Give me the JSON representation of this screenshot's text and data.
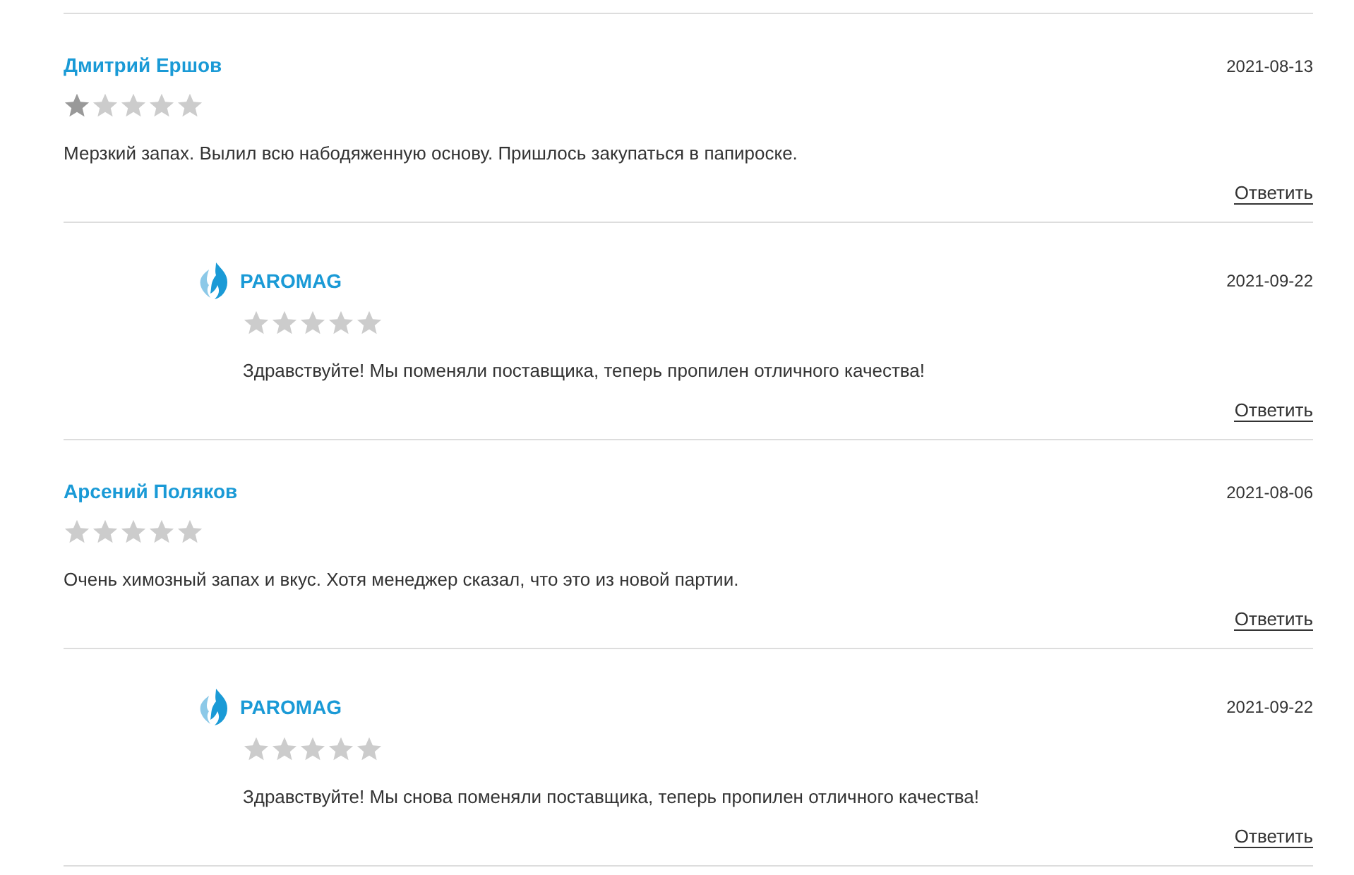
{
  "reviews": [
    {
      "kind": "customer",
      "author": "Дмитрий Ершов",
      "date": "2021-08-13",
      "stars": 1,
      "text": "Мерзкий запах. Вылил всю набодяженную основу. Пришлось закупаться в папироске.",
      "reply_link": "Ответить"
    },
    {
      "kind": "shop",
      "author": "PAROMAG",
      "date": "2021-09-22",
      "stars": 0,
      "text": "Здравствуйте! Мы поменяли поставщика, теперь пропилен отличного качества!",
      "reply_link": "Ответить"
    },
    {
      "kind": "customer",
      "author": "Арсений Поляков",
      "date": "2021-08-06",
      "stars": 0,
      "text": "Очень химозный запах и вкус. Хотя менеджер сказал, что это из новой партии.",
      "reply_link": "Ответить"
    },
    {
      "kind": "shop",
      "author": "PAROMAG",
      "date": "2021-09-22",
      "stars": 0,
      "text": "Здравствуйте! Мы снова поменяли поставщика, теперь пропилен отличного качества!",
      "reply_link": "Ответить"
    }
  ]
}
